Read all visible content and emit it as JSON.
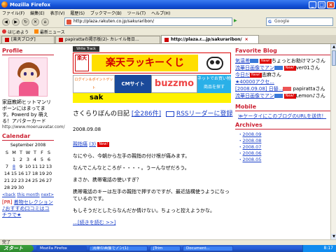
{
  "window": {
    "title": "Mozilla Firefox"
  },
  "menu": {
    "items": [
      "ファイル(F)",
      "編集(E)",
      "表示(V)",
      "履歴(S)",
      "ブックマーク(B)",
      "ツール(T)",
      "ヘルプ(H)"
    ]
  },
  "nav": {
    "url": "http://plaza.rakuten.co.jp/sakuraribon/",
    "search_engine": "G",
    "search_placeholder": "Google"
  },
  "bookmarks": {
    "items": [
      "はじめよう",
      "最新ニュース"
    ]
  },
  "tabs": [
    {
      "label": "[楽天ブログ]"
    },
    {
      "label": "papirattaの掲示板(2)- カレイル毎日..."
    },
    {
      "label": "http://plaza.r...jp/sakuraribon/"
    }
  ],
  "left": {
    "profile_heading": "Profile",
    "profile_text": "家庭教師ヒットマンリボーンにはまってます。Powerd by 萌える！アバターカード",
    "profile_link": "http://www.moeruavatar.com/",
    "calendar_heading": "Calendar",
    "calendar_month": "September 2008",
    "cal_days": [
      "S",
      "M",
      "T",
      "W",
      "T",
      "F",
      "S"
    ],
    "cal_rows": [
      [
        "",
        "1",
        "2",
        "3",
        "4",
        "5",
        "6"
      ],
      [
        "7",
        "8",
        "9",
        "10",
        "11",
        "12",
        "13"
      ],
      [
        "14",
        "15",
        "16",
        "17",
        "18",
        "19",
        "20"
      ],
      [
        "21",
        "22",
        "23",
        "24",
        "25",
        "26",
        "27"
      ],
      [
        "28",
        "29",
        "30",
        "",
        "",
        "",
        ""
      ]
    ],
    "cal_prev": "<back",
    "cal_mid": "this month",
    "cal_next": "next>",
    "pr_tag": "[PR]",
    "pr_text": "着物セレクション♪おすすめ口コミはコチラで★"
  },
  "main": {
    "mini_button": "Write Track",
    "banner_logo": "楽天",
    "banner_title": "楽天ラッキーくじ",
    "banner_a": "ログイン＆ポイントゲット",
    "banner_b": "CMサイト",
    "banner_c": "buzzmo",
    "banner_d": "ネットでお買い物 商品を探す",
    "sak": "sak",
    "post_title": "さくらりぼんの日記",
    "post_count": "[全286件]",
    "rss_link": "RSSリーダーに登録",
    "date": "2008.09.08",
    "post_link": "親指痛",
    "post_link_count": "(3)",
    "new_label": "New!",
    "para1": "なにやら、今朝から左手の親指の付け根が痛みます。",
    "para2": "なんでこんなところが・・・・。うーんなぜだろう。",
    "para3": "まさか、携帯電話の使いすぎ？",
    "para4": "携帯電話のキーは左手の親指で押すのですが、最近詰構使うようになっているのです。",
    "para5": "もしそうだとしたらなんだか情けない。ちょっと控えようかな。",
    "more_link": "…[続きを読む >>]"
  },
  "right": {
    "fav_heading": "Favorite Blog",
    "fav_items": [
      {
        "link": "気温差",
        "after": "ちょっとお助けマンさん"
      },
      {
        "link": "流華日画像でアン",
        "after": "ver01さん"
      },
      {
        "link": "今日だ",
        "after": "志麻さん"
      },
      {
        "link": "★40000アクセ...",
        "after": ""
      },
      {
        "link": "[2008.09.08] 日替...",
        "after": "papirattaさん"
      },
      {
        "link": "流華日画像でアン",
        "after": "Lemon♪さん"
      }
    ],
    "mobile_heading": "Mobile",
    "mobile_text": "≫ケータイにこのブログのURLを送信！",
    "archives_heading": "Archives",
    "archives": [
      "2008.09",
      "2008.08",
      "2008.07",
      "2008.06",
      "2008.05"
    ]
  },
  "status": {
    "text": "完了"
  },
  "taskbar": {
    "start": "スタート",
    "tasks": [
      "Mozilla Firefox",
      "流華の画像でアン(1)",
      "JTrim",
      "Document..."
    ],
    "clock": "8:17"
  }
}
